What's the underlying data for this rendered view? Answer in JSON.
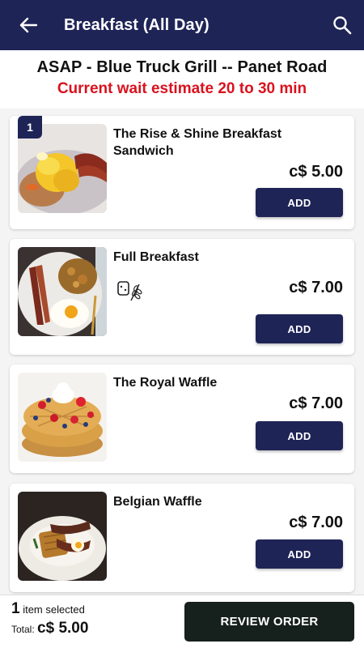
{
  "appbar": {
    "title": "Breakfast (All Day)",
    "back_icon": "arrow-left-icon",
    "search_icon": "search-icon"
  },
  "store": {
    "name": "ASAP - Blue Truck Grill -- Panet Road",
    "wait": "Current wait estimate 20 to 30 min"
  },
  "items": [
    {
      "name": "The Rise & Shine Breakfast Sandwich",
      "price": "c$ 5.00",
      "add_label": "ADD",
      "qty": "1"
    },
    {
      "name": "Full Breakfast",
      "price": "c$ 7.00",
      "add_label": "ADD",
      "diet_icon": "gluten-wheat-icon"
    },
    {
      "name": "The Royal Waffle",
      "price": "c$ 7.00",
      "add_label": "ADD"
    },
    {
      "name": "Belgian Waffle",
      "price": "c$ 7.00",
      "add_label": "ADD"
    }
  ],
  "footer": {
    "count": "1",
    "selected_text": "item selected",
    "total_label": "Total:",
    "total_value": "c$ 5.00",
    "review_label": "REVIEW ORDER"
  },
  "colors": {
    "brand": "#1f2457",
    "wait": "#d9121e",
    "review_button": "#16201d"
  }
}
